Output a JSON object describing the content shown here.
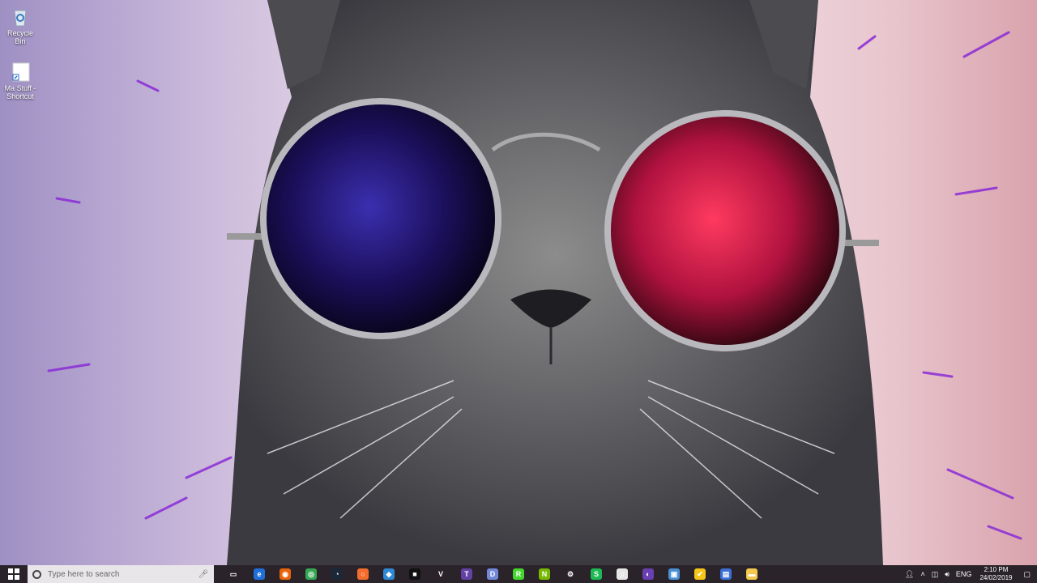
{
  "desktop": {
    "icons": [
      {
        "label": "Recycle Bin",
        "icon": "recycle-bin-icon"
      },
      {
        "label": "Ma Stuff - Shortcut",
        "icon": "folder-shortcut-icon"
      }
    ]
  },
  "taskbar": {
    "search_placeholder": "Type here to search",
    "apps": [
      {
        "name": "task-view",
        "color": "#2a2329",
        "glyph": "▭"
      },
      {
        "name": "edge",
        "color": "#1e6fd9",
        "glyph": "e"
      },
      {
        "name": "firefox",
        "color": "#e8630a",
        "glyph": "◉"
      },
      {
        "name": "chrome",
        "color": "#34a853",
        "glyph": "◎"
      },
      {
        "name": "steam",
        "color": "#1b2838",
        "glyph": "◔"
      },
      {
        "name": "origin",
        "color": "#f56c2d",
        "glyph": "○"
      },
      {
        "name": "app-blue",
        "color": "#2e89d6",
        "glyph": "◆"
      },
      {
        "name": "app-black",
        "color": "#111111",
        "glyph": "■"
      },
      {
        "name": "valorant-like",
        "color": "#2a2329",
        "glyph": "V"
      },
      {
        "name": "twitch",
        "color": "#6441a5",
        "glyph": "T"
      },
      {
        "name": "discord",
        "color": "#7289da",
        "glyph": "D"
      },
      {
        "name": "razer",
        "color": "#44d62c",
        "glyph": "R"
      },
      {
        "name": "nvidia",
        "color": "#76b900",
        "glyph": "N"
      },
      {
        "name": "settings",
        "color": "#2a2329",
        "glyph": "⚙"
      },
      {
        "name": "spotify",
        "color": "#1db954",
        "glyph": "S"
      },
      {
        "name": "itunes",
        "color": "#e6e6e6",
        "glyph": "♫"
      },
      {
        "name": "app-purple",
        "color": "#6a3fb2",
        "glyph": "◐"
      },
      {
        "name": "app-window",
        "color": "#4a8fd6",
        "glyph": "▣"
      },
      {
        "name": "norton",
        "color": "#f5c518",
        "glyph": "✔"
      },
      {
        "name": "photos",
        "color": "#3b6fd6",
        "glyph": "▤"
      },
      {
        "name": "file-explorer",
        "color": "#f2c94c",
        "glyph": "▬"
      }
    ],
    "tray": {
      "language": "ENG",
      "time": "2:10 PM",
      "date": "24/02/2019"
    }
  }
}
